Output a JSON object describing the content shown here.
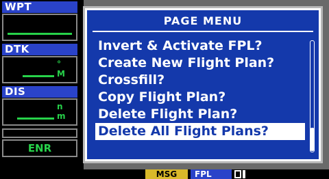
{
  "left_panel": {
    "wpt_label": "WPT",
    "dtk_label": "DTK",
    "dtk_unit_top": "°",
    "dtk_unit_bottom": "M",
    "dis_label": "DIS",
    "dis_unit_top": "n",
    "dis_unit_bottom": "m",
    "mode": "ENR"
  },
  "menu": {
    "title": "PAGE MENU",
    "items": [
      {
        "label": "Invert & Activate FPL?"
      },
      {
        "label": "Create New Flight Plan?"
      },
      {
        "label": "Crossfill?"
      },
      {
        "label": "Copy Flight Plan?"
      },
      {
        "label": "Delete Flight Plan?"
      },
      {
        "label": "Delete All Flight Plans?"
      }
    ],
    "selected_index": 5
  },
  "status_bar": {
    "msg": "MSG",
    "page": "FPL"
  },
  "colors": {
    "menu_bg": "#1439ab",
    "label_bg": "#2a43c9",
    "data_green": "#27d24a",
    "msg_yellow": "#d9b92a"
  }
}
